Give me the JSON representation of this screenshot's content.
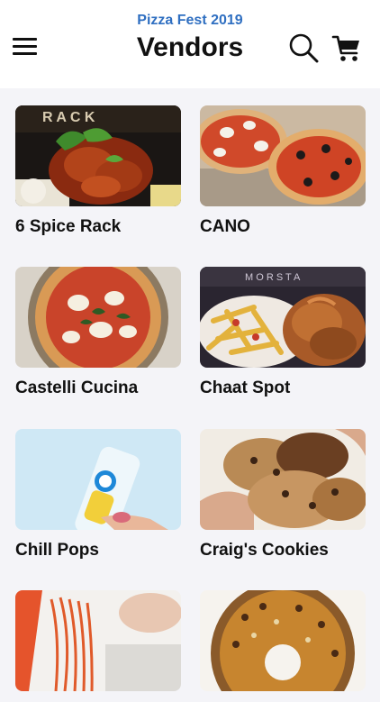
{
  "header": {
    "event_name": "Pizza Fest 2019",
    "title": "Vendors",
    "menu_icon": "hamburger-menu-icon",
    "search_icon": "search-icon",
    "cart_icon": "shopping-cart-icon"
  },
  "vendors": [
    {
      "name": "6 Spice Rack",
      "image": "fried-chicken-photo"
    },
    {
      "name": "CANO",
      "image": "pizzas-photo"
    },
    {
      "name": "Castelli Cucina",
      "image": "margherita-pizza-photo"
    },
    {
      "name": "Chaat Spot",
      "image": "loaded-fries-photo"
    },
    {
      "name": "Chill Pops",
      "image": "ice-pop-photo"
    },
    {
      "name": "Craig's Cookies",
      "image": "cookies-photo"
    },
    {
      "name": "",
      "image": "spaghetti-photo"
    },
    {
      "name": "",
      "image": "donut-photo"
    }
  ],
  "colors": {
    "accent": "#2f6fc1",
    "background": "#f4f4f8"
  }
}
